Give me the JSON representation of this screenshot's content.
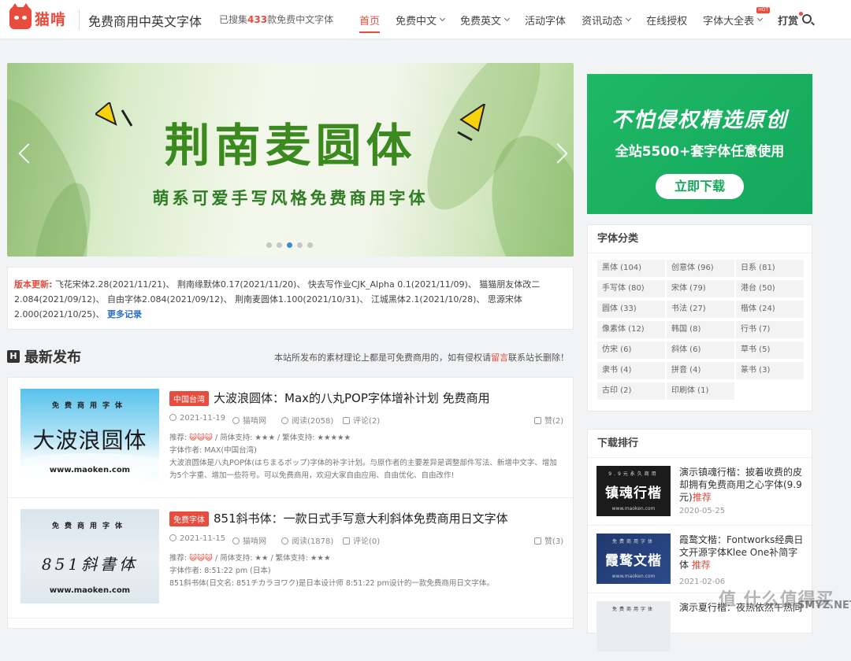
{
  "header": {
    "logo_text": "猫啃",
    "site_title": "免费商用中英文字体",
    "stats_prefix": "已搜集",
    "stats_count": "433",
    "stats_suffix": "款免费中文字体",
    "nav": [
      "首页",
      "免费中文",
      "免费英文",
      "活动字体",
      "资讯动态",
      "在线授权",
      "字体大全表",
      "打赏"
    ],
    "hot_badge": "HOT"
  },
  "banner": {
    "title": "荆南麦圆体",
    "subtitle": "萌系可爱手写风格免费商用字体",
    "slide_count": 5,
    "active_slide": 3
  },
  "ad": {
    "title": "不怕侵权精选原创",
    "subtitle": "全站5500+套字体任意使用",
    "button": "立即下载"
  },
  "updates": {
    "label": "版本更新:",
    "text": "飞花宋体2.28(2021/11/21)、 荆南缘默体0.17(2021/11/20)、 快去写作业CJK_Alpha 0.1(2021/11/09)、 猫猫朋友体改二 2.084(2021/09/12)、 自由字体2.084(2021/09/12)、 荆南麦圆体1.100(2021/10/31)、 江城黑体2.1(2021/10/28)、 思源宋体2.000(2021/10/25)、",
    "more": "更多记录"
  },
  "section": {
    "icon": "H",
    "title": "最新发布",
    "note_pre": "本站所发布的素材理论上都是可免费商用的，如有侵权请",
    "note_link": "留言",
    "note_post": "联系站长删除！"
  },
  "posts": [
    {
      "tag": "中国台湾",
      "title": "大波浪圆体：Max的八丸POP字体增补计划 免费商用",
      "date": "2021-11-19",
      "author": "猫啃网",
      "views": "阅读(2058)",
      "comments": "评论(2)",
      "likes": "赞(2)",
      "rec_label": "推荐:",
      "rec_icons": "😺😺😺",
      "support": " / 简体支持: ★★★ / 繁体支持: ★★★★★",
      "author_line": "字体作者: MAX(中国台湾)",
      "desc1": "大波浪圆体是八丸POP体(はちまるポップ)字体的补字计划。与原作者的主要差异是调整部件写法、新增中文字、增加",
      "desc2": "为5个字重、增加一些符号。可以免费商用，欢迎大家自由应用、自由优化、自由改作!",
      "thumb_top": "免费商用字体",
      "thumb_main": "大波浪圆体",
      "thumb_url": "www.maoken.com"
    },
    {
      "tag": "免费字体",
      "title": "851斜书体：一款日式手写意大利斜体免费商用日文字体",
      "date": "2021-11-15",
      "author": "猫啃网",
      "views": "阅读(1878)",
      "comments": "评论(0)",
      "likes": "赞(3)",
      "rec_label": "推荐:",
      "rec_icons": "😺😺😺",
      "support": " / 简体支持: ★★ / 繁体支持: ★★★",
      "author_line": "字体作者: 8:51:22 pm (日本)",
      "desc1": "851斜书体(日文名: 851チカラヨワク)是日本设计师 8:51:22 pm设计的一款免费商用日文字体。",
      "desc2": "",
      "thumb_top": "免费商用字体",
      "thumb_main": "851斜書体",
      "thumb_url": "www.maoken.com"
    }
  ],
  "categories": {
    "title": "字体分类",
    "items": [
      "黑体 (104)",
      "创意体 (96)",
      "日系 (81)",
      "手写体 (80)",
      "宋体 (79)",
      "港台 (50)",
      "圆体 (33)",
      "书法 (27)",
      "楷体 (24)",
      "像素体 (12)",
      "韩国 (8)",
      "行书 (7)",
      "仿宋 (6)",
      "斜体 (6)",
      "草书 (5)",
      "隶书 (4)",
      "拼音 (4)",
      "篆书 (3)",
      "古印 (2)",
      "印刷体 (1)"
    ]
  },
  "ranking": {
    "title": "下载排行",
    "items": [
      {
        "title": "演示镇魂行楷：披着收费的皮却拥有免费商用之心字体(9.9元)",
        "rec": "推荐",
        "date": "2020-05-25",
        "thumb_top": "9.9元永久商用",
        "thumb_main": "镇魂行楷",
        "thumb_url": "www.maoken.com"
      },
      {
        "title": "霞鹜文楷：Fontworks经典日文开源字体Klee One补简字体",
        "rec": "推荐",
        "date": "2021-02-06",
        "thumb_top": "免费商用字体",
        "thumb_main": "霞鹜文楷",
        "thumb_url": "www.maoken.com"
      },
      {
        "title": "演示夏行楷：夜热依然午热同",
        "rec": "",
        "date": "",
        "thumb_top": "免费商用字体",
        "thumb_main": "",
        "thumb_url": ""
      }
    ]
  },
  "watermark": {
    "text": "值 什么值得买",
    "url": "SMYZ.NET"
  }
}
